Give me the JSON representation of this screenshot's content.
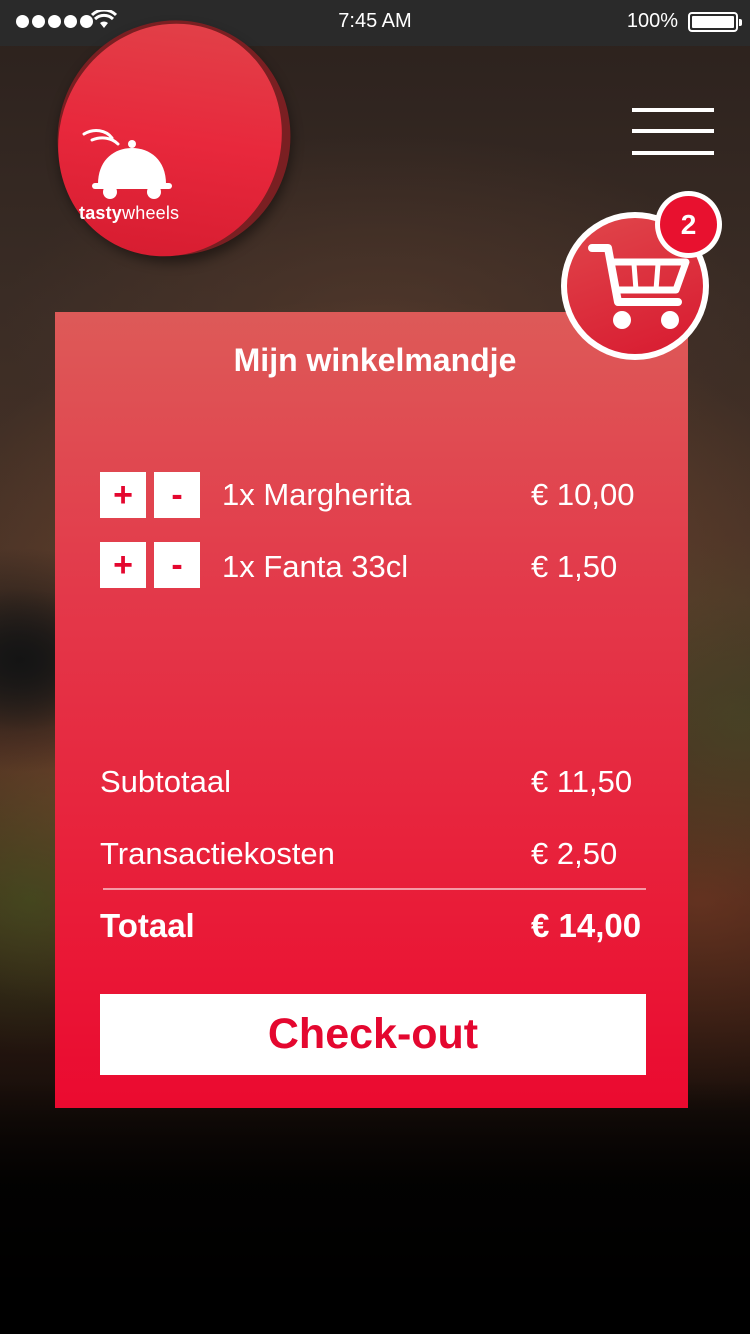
{
  "status_bar": {
    "time": "7:45 AM",
    "battery": "100%"
  },
  "logo": {
    "brand_bold": "tasty",
    "brand_light": "wheels"
  },
  "cart": {
    "title": "Mijn winkelmandje",
    "badge_count": "2",
    "plus_label": "+",
    "minus_label": "-",
    "items": [
      {
        "name": "1x Margherita",
        "price": "€ 10,00"
      },
      {
        "name": "1x Fanta 33cl",
        "price": "€ 1,50"
      }
    ],
    "summary": {
      "subtotal_label": "Subtotaal",
      "subtotal_value": "€ 11,50",
      "fee_label": "Transactiekosten",
      "fee_value": "€ 2,50",
      "total_label": "Totaal",
      "total_value": "€ 14,00"
    },
    "checkout_label": "Check-out"
  },
  "colors": {
    "brand_red": "#e4072f",
    "panel_top": "#dd5a58",
    "panel_bottom": "#eb0a30"
  }
}
